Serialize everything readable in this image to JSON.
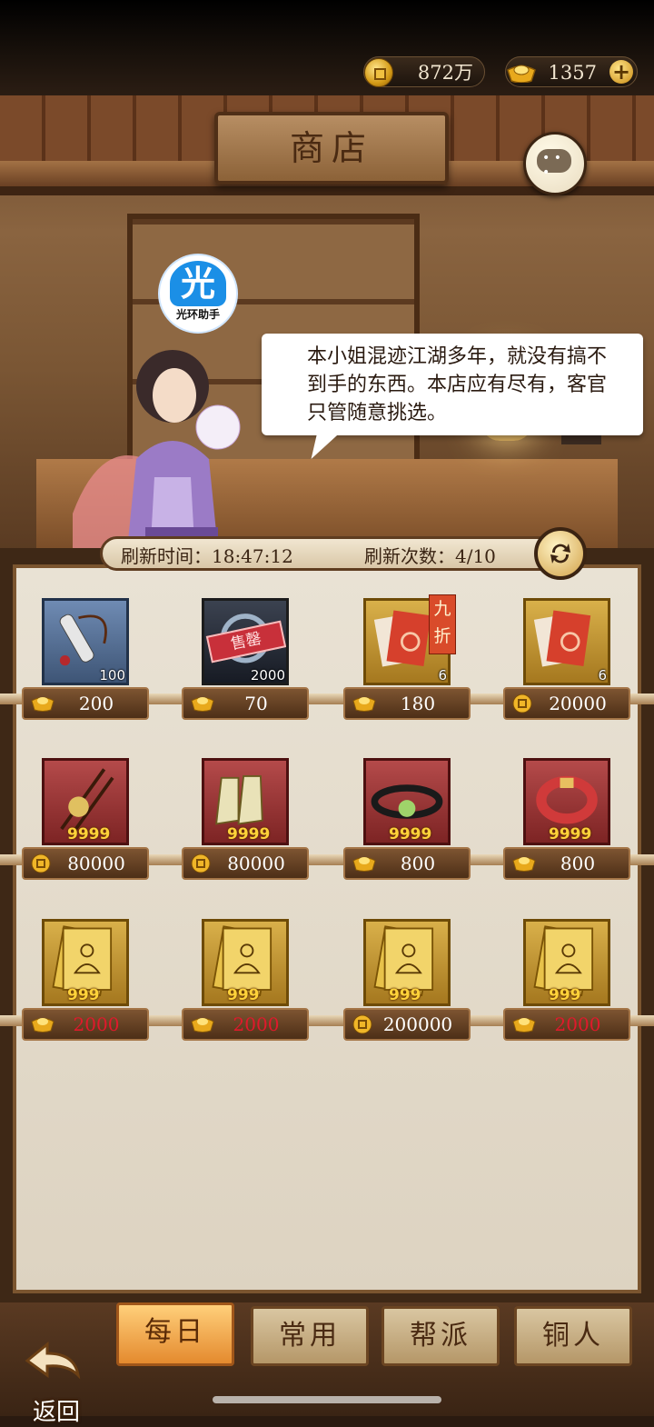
{
  "status": {
    "coins": "872万",
    "ingots": "1357",
    "plus": "+"
  },
  "shop": {
    "title": "商店",
    "badge_main": "光",
    "badge_text": "光环助手",
    "dialog": "本小姐混迹江湖多年，就没有搞不到手的东西。本店应有尽有，客官只管随意挑选。",
    "refresh_time_label": "刷新时间：18:47:12",
    "refresh_count_label": "刷新次数：4/10"
  },
  "items": [
    {
      "icon": "scroll-icon",
      "frame": "blue",
      "qty": "100",
      "currency": "ingot",
      "price": "200",
      "price_red": false
    },
    {
      "icon": "sold-item-icon",
      "frame": "dark",
      "qty": "2000",
      "sold": "售罄",
      "currency": "ingot",
      "price": "70",
      "price_red": false
    },
    {
      "icon": "red-book-icon",
      "frame": "gold",
      "qty": "6",
      "discount": "九折",
      "currency": "ingot",
      "price": "180",
      "price_red": false
    },
    {
      "icon": "red-book-icon",
      "frame": "gold",
      "qty": "6",
      "currency": "coin",
      "price": "20000",
      "price_red": false
    },
    {
      "icon": "hairpin-icon",
      "frame": "red",
      "qty": "9999",
      "currency": "coin",
      "price": "80000",
      "price_red": false
    },
    {
      "icon": "boots-icon",
      "frame": "red",
      "qty": "9999",
      "currency": "coin",
      "price": "80000",
      "price_red": false
    },
    {
      "icon": "belt-icon",
      "frame": "red",
      "qty": "9999",
      "currency": "ingot",
      "price": "800",
      "price_red": false
    },
    {
      "icon": "bracelet-icon",
      "frame": "red",
      "qty": "9999",
      "currency": "ingot",
      "price": "800",
      "price_red": false
    },
    {
      "icon": "martial-manual-icon",
      "frame": "gold",
      "qty": "999",
      "currency": "ingot",
      "price": "2000",
      "price_red": true
    },
    {
      "icon": "martial-manual-icon",
      "frame": "gold",
      "qty": "999",
      "currency": "ingot",
      "price": "2000",
      "price_red": true
    },
    {
      "icon": "martial-manual-icon",
      "frame": "gold",
      "qty": "999",
      "currency": "coin",
      "price": "200000",
      "price_red": false
    },
    {
      "icon": "martial-manual-icon",
      "frame": "gold",
      "qty": "999",
      "currency": "ingot",
      "price": "2000",
      "price_red": true
    }
  ],
  "tabs": [
    {
      "label": "每日",
      "active": true
    },
    {
      "label": "常用",
      "active": false
    },
    {
      "label": "帮派",
      "active": false
    },
    {
      "label": "铜人",
      "active": false
    }
  ],
  "back_label": "返回",
  "colors": {
    "price_red": "#e0192c",
    "tab_active": "#e48a2e"
  }
}
